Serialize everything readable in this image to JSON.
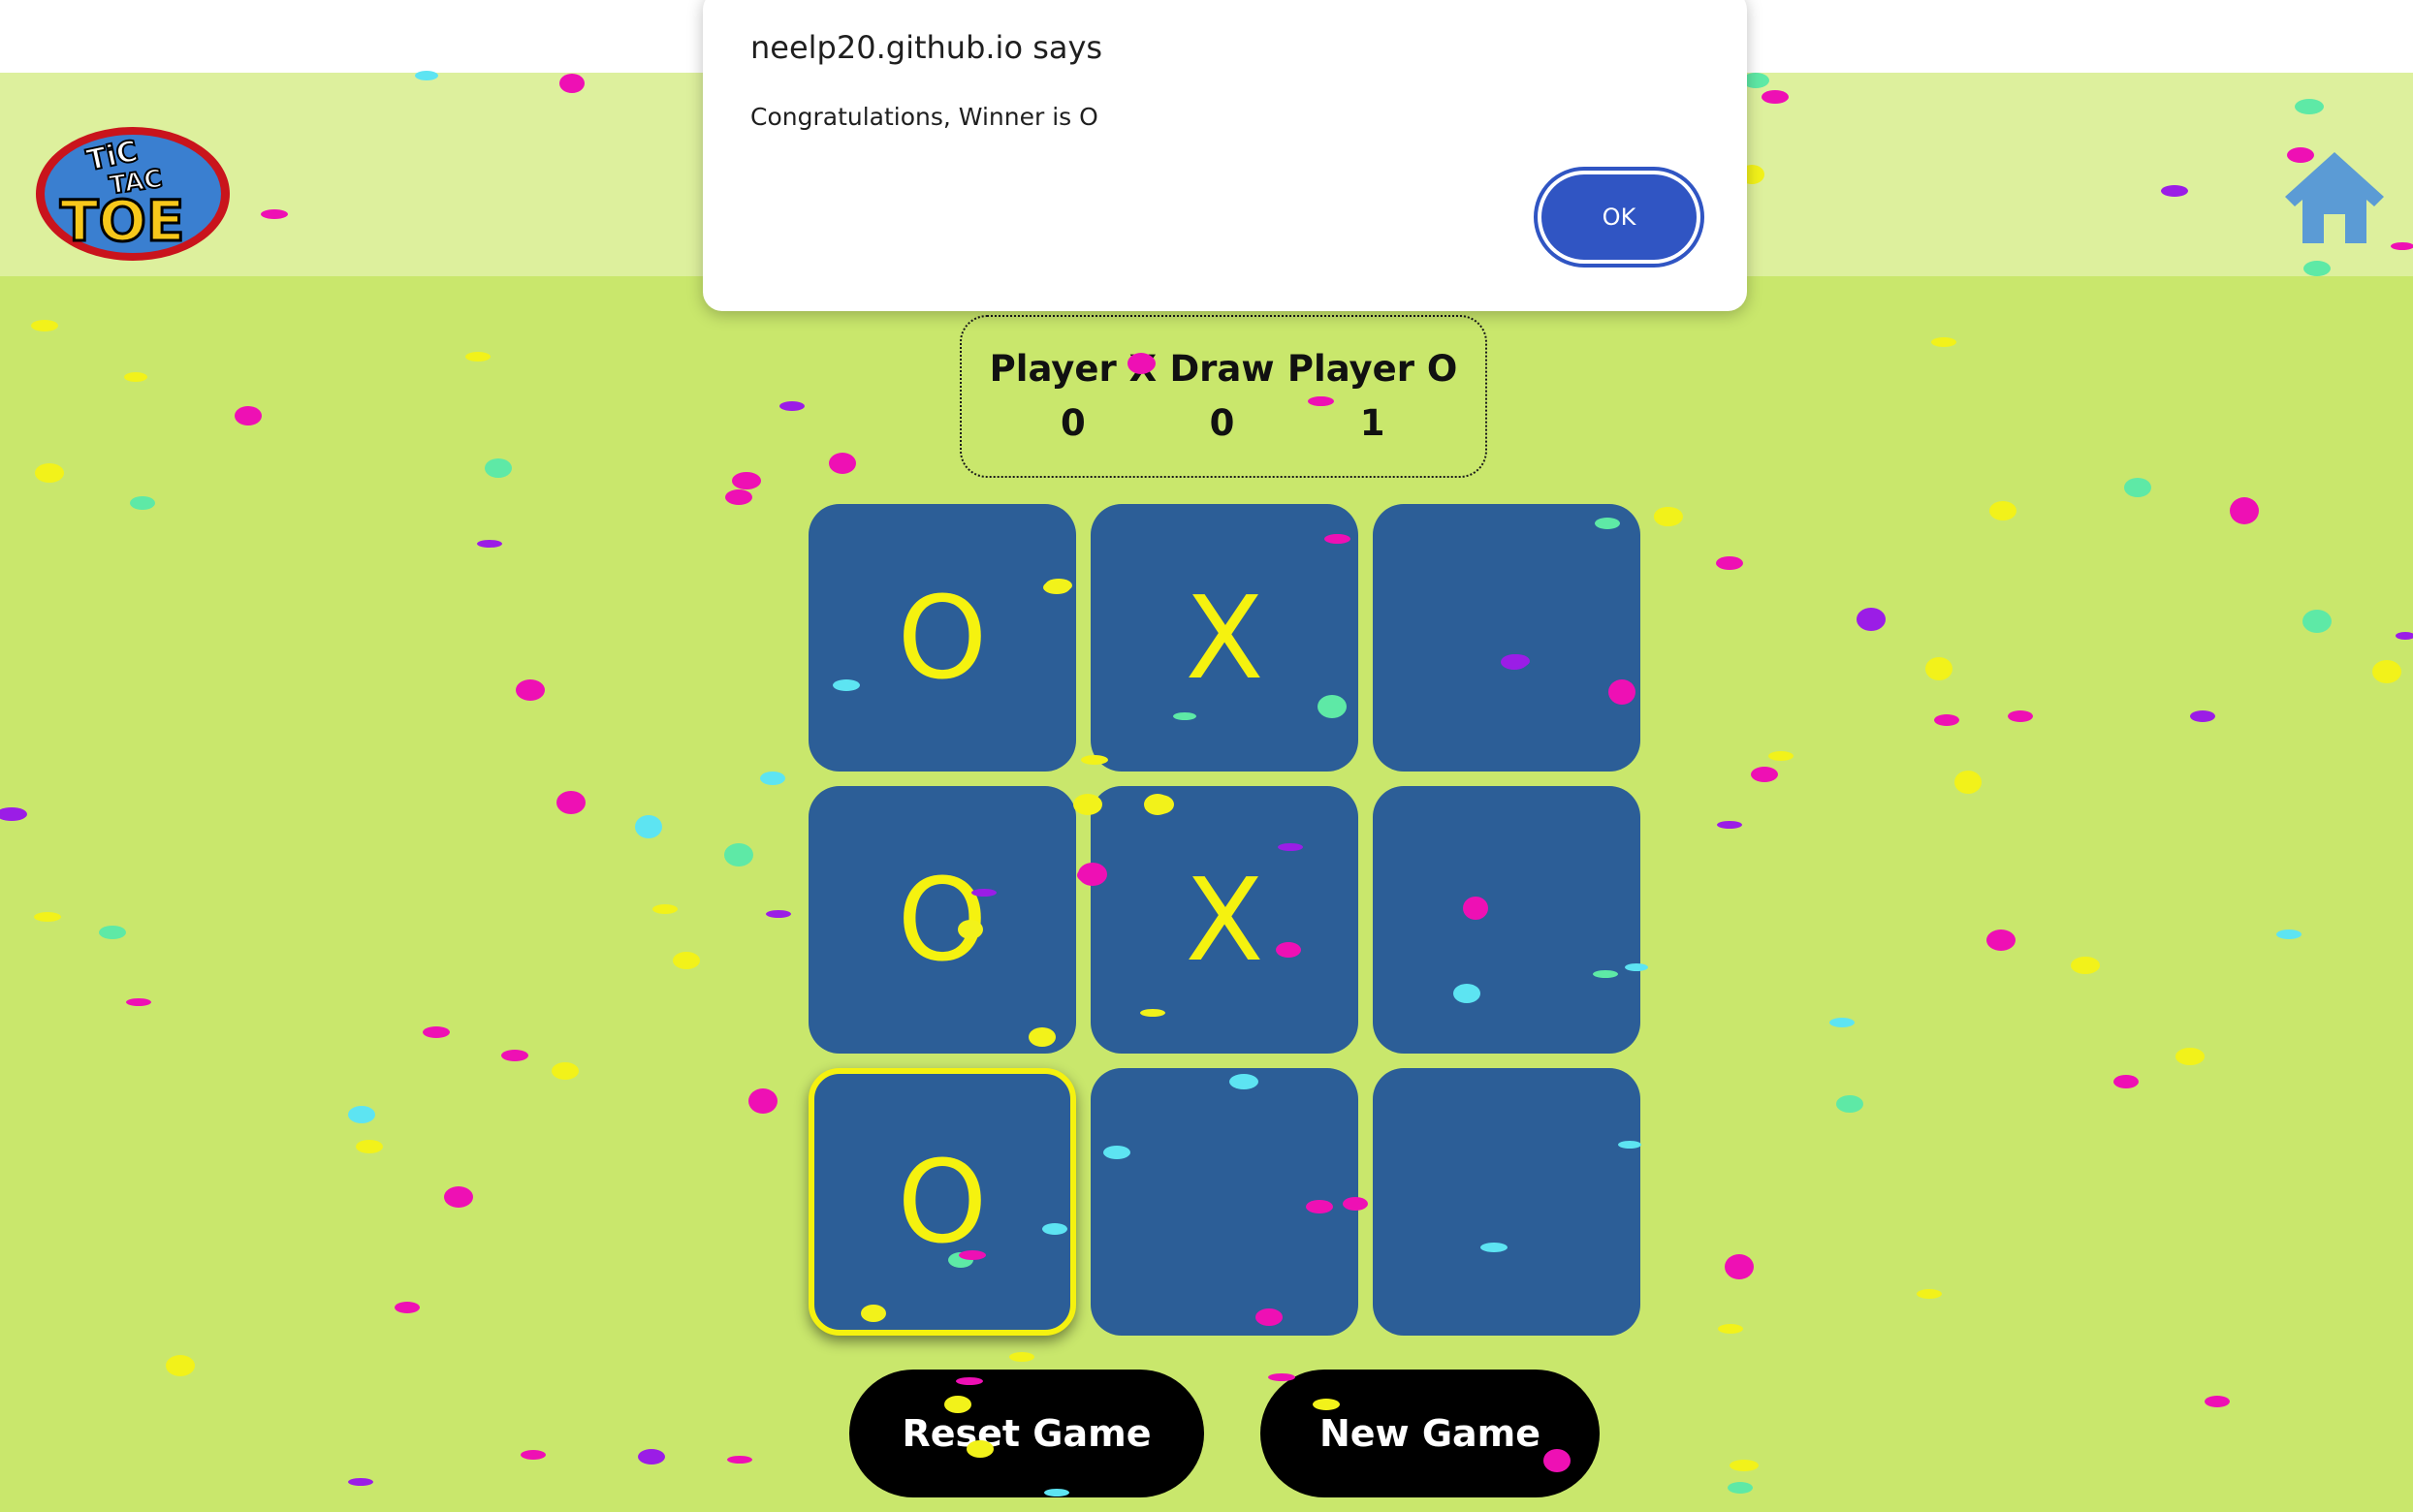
{
  "dialog": {
    "title": "neelp20.github.io says",
    "message": "Congratulations, Winner is O",
    "ok_label": "OK"
  },
  "logo": {
    "line1": "TiC",
    "line2": "TAC",
    "line3": "TOE"
  },
  "scoreboard": {
    "player_x_label": "Player X",
    "player_x_score": "0",
    "draw_label": "Draw",
    "draw_score": "0",
    "player_o_label": "Player O",
    "player_o_score": "1"
  },
  "board": {
    "cells": [
      "O",
      "X",
      "",
      "O",
      "X",
      "",
      "O",
      "",
      ""
    ]
  },
  "buttons": {
    "reset_label": "Reset Game",
    "new_label": "New Game"
  },
  "colors": {
    "background": "#c9e76c",
    "header": "#ddf09d",
    "cell": "#2c5e97",
    "mark": "#f5f20f",
    "button": "#000000",
    "ok_button": "#3055c3",
    "home_icon": "#5b9bd5"
  },
  "icons": {
    "home": "home-icon",
    "logo": "tic-tac-toe-logo"
  }
}
